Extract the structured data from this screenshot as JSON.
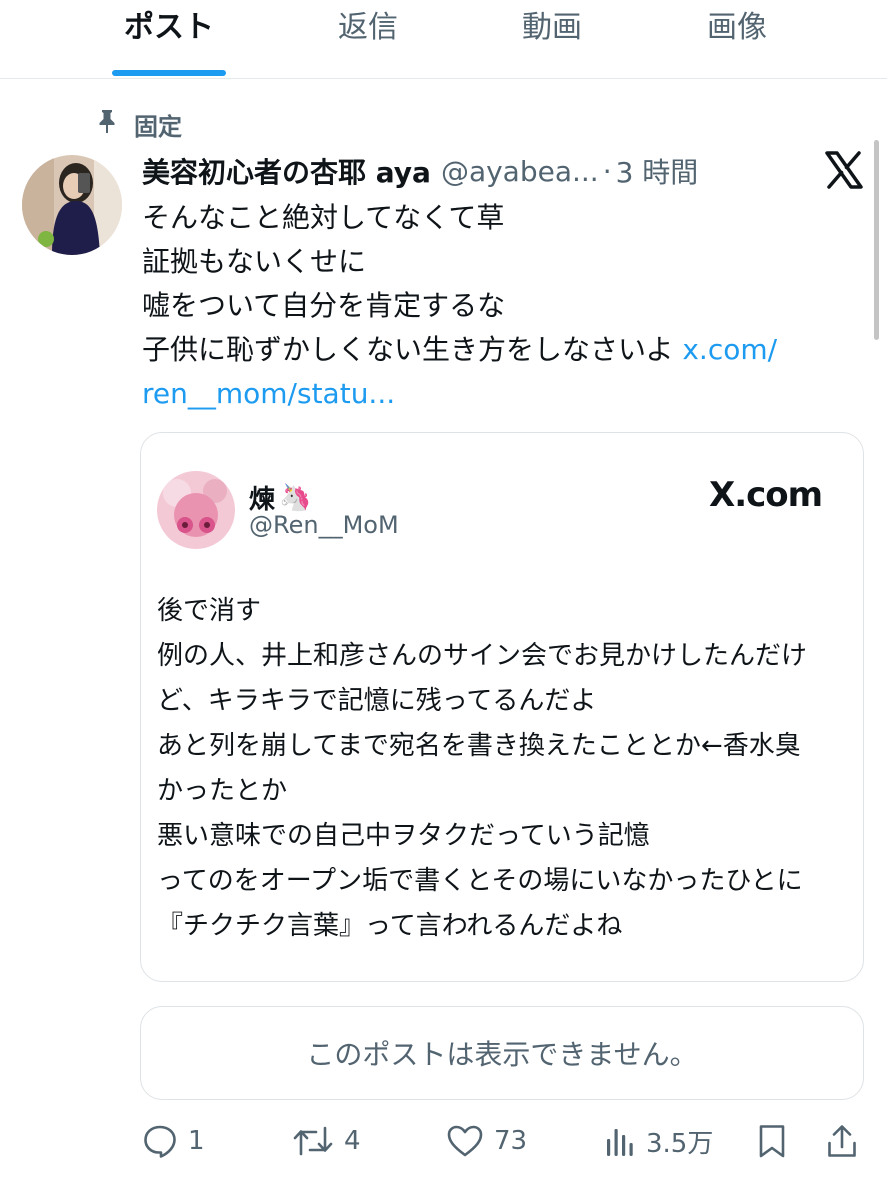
{
  "tabs": [
    {
      "label": "ポスト",
      "active": true
    },
    {
      "label": "返信",
      "active": false
    },
    {
      "label": "動画",
      "active": false
    },
    {
      "label": "画像",
      "active": false
    }
  ],
  "pinned": {
    "icon": "pin-icon",
    "label": "固定"
  },
  "post": {
    "author_name": "美容初心者の杏耶 aya",
    "handle": "@ayabea...",
    "separator": "·",
    "time": "3 時間",
    "source_icon": "x-logo-icon",
    "text_lines": [
      "そんなこと絶対してなくて草",
      "証拠もないくせに",
      "嘘をついて自分を肯定するな",
      "子供に恥ずかしくない生き方をしなさいよ"
    ],
    "link_part1": "x.com/",
    "link_part2": "ren__mom/statu..."
  },
  "quote_card": {
    "author_name": "煉",
    "name_emoji": "🦄",
    "handle": "@Ren__MoM",
    "site": "X.com",
    "body_lines": [
      "後で消す",
      "例の人、井上和彦さんのサイン会でお見かけしたんだけ",
      "ど、キラキラで記憶に残ってるんだよ",
      "あと列を崩してまで宛名を書き換えたこととか←香水臭",
      "かったとか",
      "悪い意味での自己中ヲタクだっていう記憶",
      "ってのをオープン垢で書くとその場にいなかったひとに",
      "『チクチク言葉』って言われるんだよね"
    ]
  },
  "unavailable_notice": "このポストは表示できません。",
  "actions": {
    "reply_count": "1",
    "repost_count": "4",
    "like_count": "73",
    "view_count": "3.5万"
  },
  "colors": {
    "accent": "#1d9bf0",
    "text": "#0f1419",
    "muted": "#536471",
    "border": "#dfe3e6"
  }
}
